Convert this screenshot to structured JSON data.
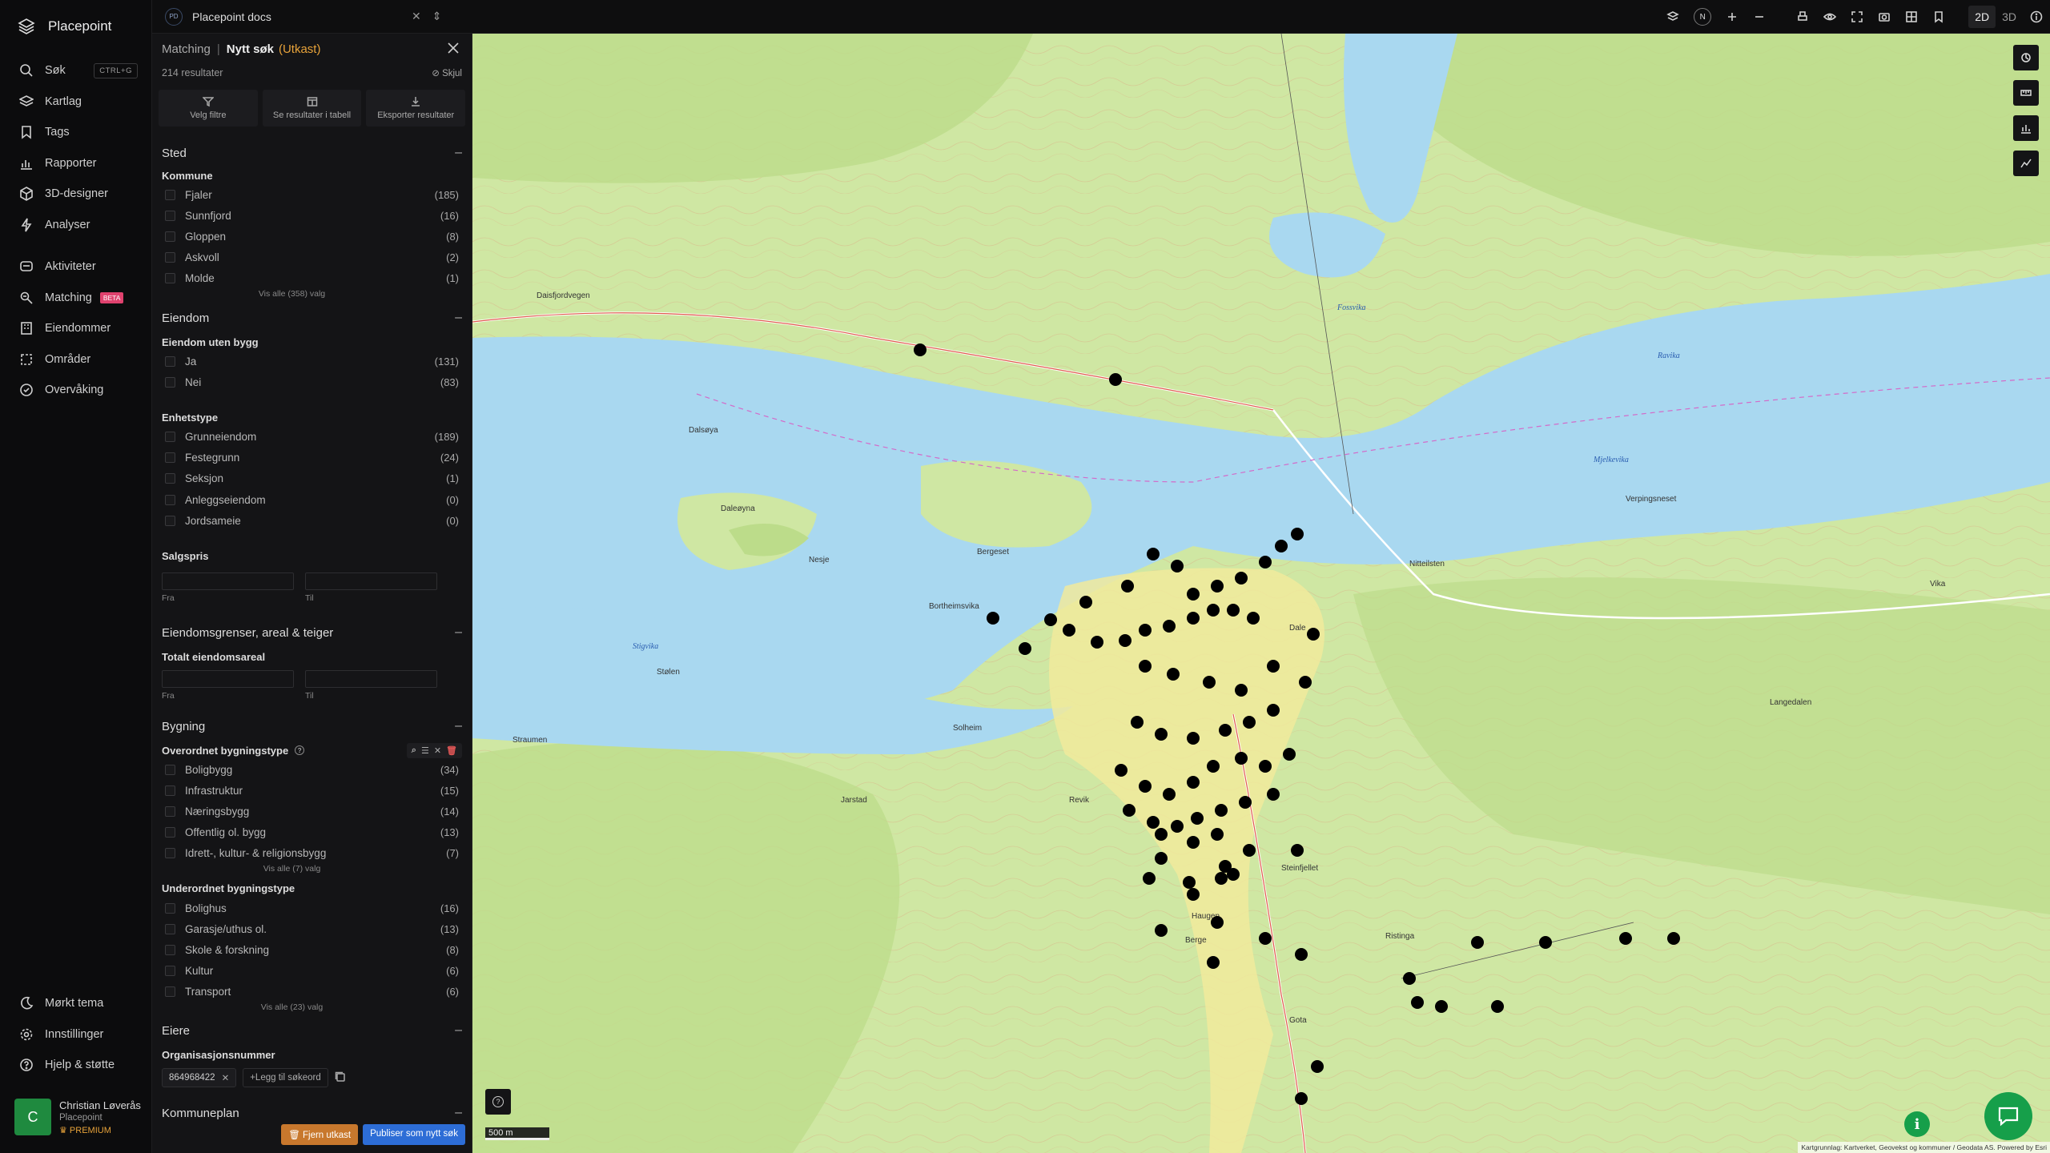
{
  "app": {
    "brand": "Placepoint"
  },
  "nav": {
    "items": [
      {
        "label": "Søk",
        "icon": "search-icon",
        "shortcut": "CTRL+G"
      },
      {
        "label": "Kartlag",
        "icon": "layers-icon"
      },
      {
        "label": "Tags",
        "icon": "bookmark-icon"
      },
      {
        "label": "Rapporter",
        "icon": "bar-chart-icon"
      },
      {
        "label": "3D-designer",
        "icon": "cube-icon"
      },
      {
        "label": "Analyser",
        "icon": "lightning-icon"
      }
    ],
    "items2": [
      {
        "label": "Aktiviteter",
        "icon": "activity-icon"
      },
      {
        "label": "Matching",
        "icon": "matching-icon",
        "badge": "BETA"
      },
      {
        "label": "Eiendommer",
        "icon": "building-icon"
      },
      {
        "label": "Områder",
        "icon": "area-icon"
      },
      {
        "label": "Overvåking",
        "icon": "monitor-icon"
      }
    ],
    "bottom": [
      {
        "label": "Mørkt tema",
        "icon": "moon-icon"
      },
      {
        "label": "Innstillinger",
        "icon": "gear-icon"
      },
      {
        "label": "Hjelp & støtte",
        "icon": "help-icon"
      }
    ],
    "user": {
      "initial": "C",
      "name": "Christian Løverås",
      "org": "Placepoint",
      "plan": "PREMIUM"
    }
  },
  "topbar": {
    "workspace_badge": "PD",
    "workspace_name": "Placepoint docs",
    "compass": "N",
    "view_2d": "2D",
    "view_3d": "3D"
  },
  "panel": {
    "crumb": "Matching",
    "title": "Nytt søk",
    "status": "(Utkast)",
    "result_count": "214 resultater",
    "hide_label": "Skjul",
    "actions": [
      "Velg filtre",
      "Se resultater i tabell",
      "Eksporter resultater"
    ],
    "sted": {
      "title": "Sted",
      "group": "Kommune",
      "options": [
        {
          "label": "Fjaler",
          "count": "(185)"
        },
        {
          "label": "Sunnfjord",
          "count": "(16)"
        },
        {
          "label": "Gloppen",
          "count": "(8)"
        },
        {
          "label": "Askvoll",
          "count": "(2)"
        },
        {
          "label": "Molde",
          "count": "(1)"
        }
      ],
      "show_all": "Vis alle (358) valg"
    },
    "eiendom": {
      "title": "Eiendom",
      "group1": "Eiendom uten bygg",
      "options1": [
        {
          "label": "Ja",
          "count": "(131)"
        },
        {
          "label": "Nei",
          "count": "(83)"
        }
      ],
      "group2": "Enhetstype",
      "options2": [
        {
          "label": "Grunneiendom",
          "count": "(189)"
        },
        {
          "label": "Festegrunn",
          "count": "(24)"
        },
        {
          "label": "Seksjon",
          "count": "(1)"
        },
        {
          "label": "Anleggseiendom",
          "count": "(0)"
        },
        {
          "label": "Jordsameie",
          "count": "(0)"
        }
      ],
      "group3": "Salgspris",
      "from": "Fra",
      "to": "Til"
    },
    "areal": {
      "title": "Eiendomsgrenser, areal & teiger",
      "group": "Totalt eiendomsareal",
      "from": "Fra",
      "to": "Til"
    },
    "bygning": {
      "title": "Bygning",
      "group1": "Overordnet bygningstype",
      "options1": [
        {
          "label": "Boligbygg",
          "count": "(34)"
        },
        {
          "label": "Infrastruktur",
          "count": "(15)"
        },
        {
          "label": "Næringsbygg",
          "count": "(14)"
        },
        {
          "label": "Offentlig ol. bygg",
          "count": "(13)"
        },
        {
          "label": "Idrett-, kultur- & religionsbygg",
          "count": "(7)"
        }
      ],
      "show_all1": "Vis alle (7) valg",
      "group2": "Underordnet bygningstype",
      "options2": [
        {
          "label": "Bolighus",
          "count": "(16)"
        },
        {
          "label": "Garasje/uthus ol.",
          "count": "(13)"
        },
        {
          "label": "Skole & forskning",
          "count": "(8)"
        },
        {
          "label": "Kultur",
          "count": "(6)"
        },
        {
          "label": "Transport",
          "count": "(6)"
        }
      ],
      "show_all2": "Vis alle (23) valg"
    },
    "eiere": {
      "title": "Eiere",
      "group": "Organisasjonsnummer",
      "chip": "864968422",
      "add_keyword": "Legg til søkeord"
    },
    "kommuneplan": {
      "title": "Kommuneplan"
    },
    "remove_draft": "Fjern utkast",
    "publish": "Publiser som nytt søk"
  },
  "map": {
    "scale": "500 m",
    "attribution": "Kartgrunnlag: Kartverket, Geovekst og kommuner / Geodata AS. Powered by Esri",
    "labels": [
      "Daisfjordvegen",
      "Dalsøya",
      "Daleøyna",
      "Solheim",
      "Straumen",
      "Dale",
      "Vika",
      "Nesje",
      "Nitteilsten",
      "Bortheimsvika",
      "Stølen",
      "Revik",
      "Jarstad",
      "Haugen",
      "Berge",
      "Gota",
      "Fossvika",
      "Mjelkevika",
      "Bergeset",
      "Verpingsneset",
      "Langedalen",
      "Steinfjellet",
      "Ristinga"
    ],
    "water_labels": [
      "Fossvika",
      "Mjelkevika",
      "Stigvika",
      "Ravika"
    ],
    "colors": {
      "water": "#a9d8f0",
      "land": "#cfe7a3",
      "forest": "#b9db86",
      "urban": "#f1ea9c",
      "marker": "#000000"
    }
  }
}
